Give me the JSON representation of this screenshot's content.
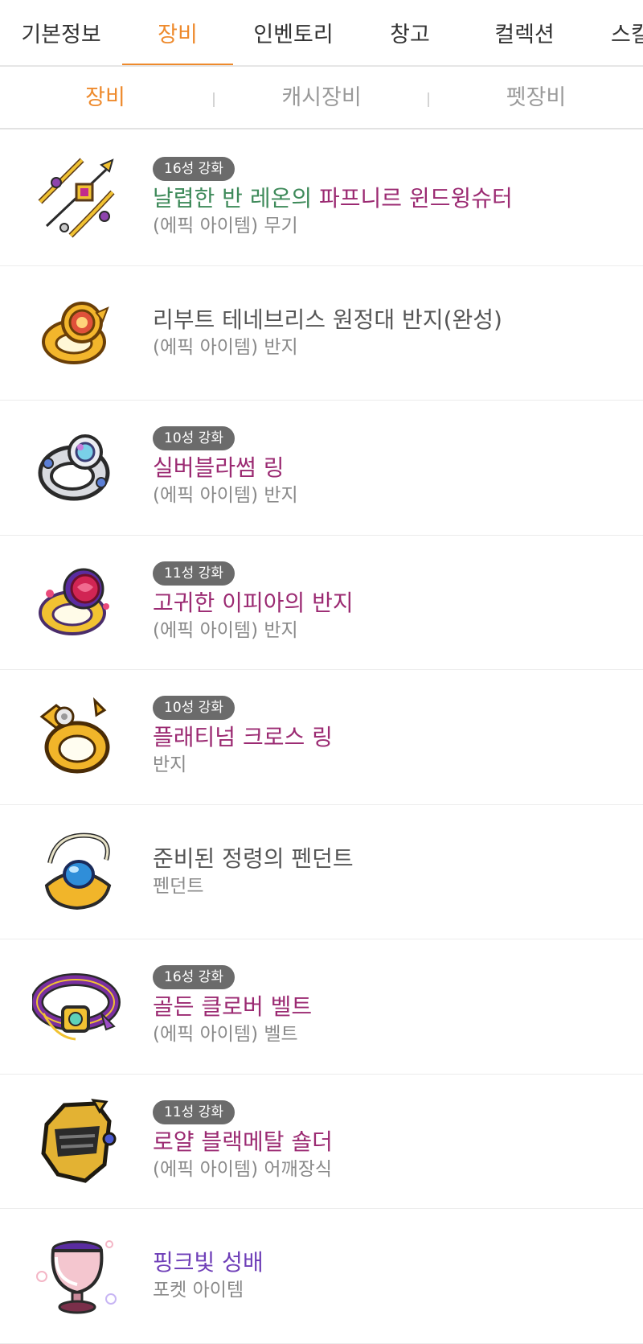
{
  "nav": {
    "tabs": [
      {
        "label": "기본정보",
        "active": false
      },
      {
        "label": "장비",
        "active": true
      },
      {
        "label": "인벤토리",
        "active": false
      },
      {
        "label": "창고",
        "active": false
      },
      {
        "label": "컬렉션",
        "active": false
      },
      {
        "label": "스킬",
        "active": false
      }
    ],
    "active_color": "#ee8a2c"
  },
  "subnav": {
    "tabs": [
      {
        "label": "장비",
        "active": true
      },
      {
        "label": "캐시장비",
        "active": false
      },
      {
        "label": "펫장비",
        "active": false
      }
    ]
  },
  "items": [
    {
      "badge": "16성 강화",
      "prefix": "날렵한 반 레온의",
      "name": "파프니르 윈드윙슈터",
      "subtitle": "(에픽 아이템) 무기",
      "icon": "bow-weapon-icon",
      "color": "#9b2a72"
    },
    {
      "badge": "",
      "prefix": "",
      "name": "리부트 테네브리스 원정대 반지(완성)",
      "subtitle": "(에픽 아이템) 반지",
      "icon": "gold-ring-icon",
      "color": "#555555"
    },
    {
      "badge": "10성 강화",
      "prefix": "",
      "name": "실버블라썸 링",
      "subtitle": "(에픽 아이템) 반지",
      "icon": "silver-ring-icon",
      "color": "#9b2a72"
    },
    {
      "badge": "11성 강화",
      "prefix": "",
      "name": "고귀한 이피아의 반지",
      "subtitle": "(에픽 아이템) 반지",
      "icon": "rose-ring-icon",
      "color": "#9b2a72"
    },
    {
      "badge": "10성 강화",
      "prefix": "",
      "name": "플래티넘 크로스 링",
      "subtitle": "반지",
      "icon": "cross-ring-icon",
      "color": "#9b2a72"
    },
    {
      "badge": "",
      "prefix": "",
      "name": "준비된 정령의 펜던트",
      "subtitle": "펜던트",
      "icon": "pendant-icon",
      "color": "#555555"
    },
    {
      "badge": "16성 강화",
      "prefix": "",
      "name": "골든 클로버 벨트",
      "subtitle": "(에픽 아이템) 벨트",
      "icon": "belt-icon",
      "color": "#9b2a72"
    },
    {
      "badge": "11성 강화",
      "prefix": "",
      "name": "로얄 블랙메탈 숄더",
      "subtitle": "(에픽 아이템) 어깨장식",
      "icon": "shoulder-icon",
      "color": "#9b2a72"
    },
    {
      "badge": "",
      "prefix": "",
      "name": "핑크빛 성배",
      "subtitle": "포켓 아이템",
      "icon": "chalice-icon",
      "color": "#6f3fb8"
    }
  ]
}
